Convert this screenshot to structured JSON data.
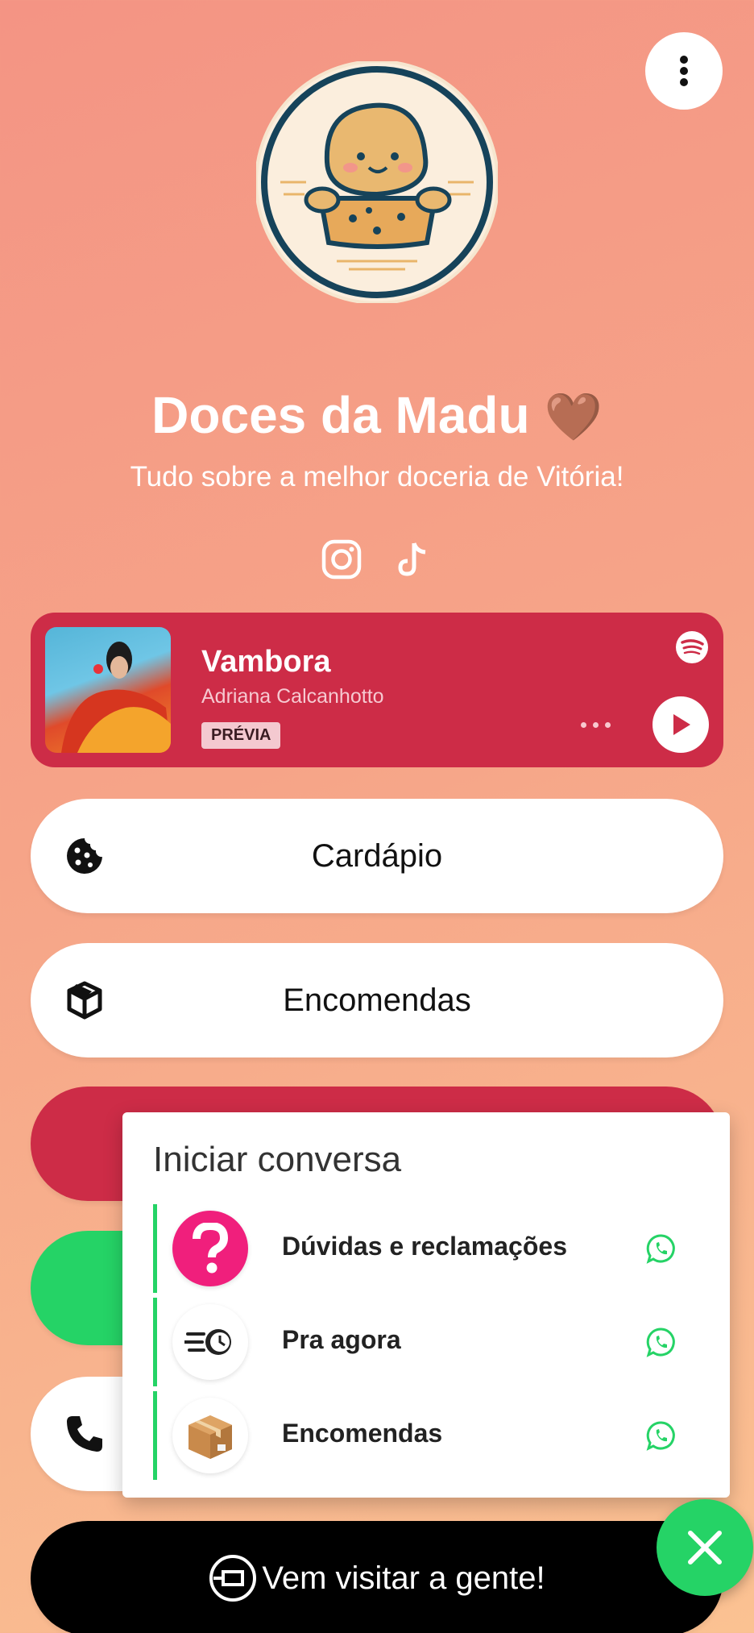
{
  "profile": {
    "name": "Doces da Madu",
    "heart_emoji": "🤎",
    "bio": "Tudo sobre a melhor doceria de Vitória!"
  },
  "social": [
    "instagram-icon",
    "tiktok-icon"
  ],
  "spotify": {
    "song": "Vambora",
    "artist": "Adriana Calcanhotto",
    "badge": "PRÉVIA"
  },
  "links": {
    "cardapio": "Cardápio",
    "encomendas": "Encomendas",
    "visit": "Vem visitar a gente!"
  },
  "chat": {
    "title": "Iniciar conversa",
    "items": [
      {
        "label": "Dúvidas e reclamações",
        "icon": "question-icon"
      },
      {
        "label": "Pra agora",
        "icon": "fast-clock-icon"
      },
      {
        "label": "Encomendas",
        "icon": "package-icon"
      }
    ]
  },
  "colors": {
    "accent_red": "#cd2c47",
    "whatsapp_green": "#25d366",
    "question_pink": "#f01f7c"
  }
}
